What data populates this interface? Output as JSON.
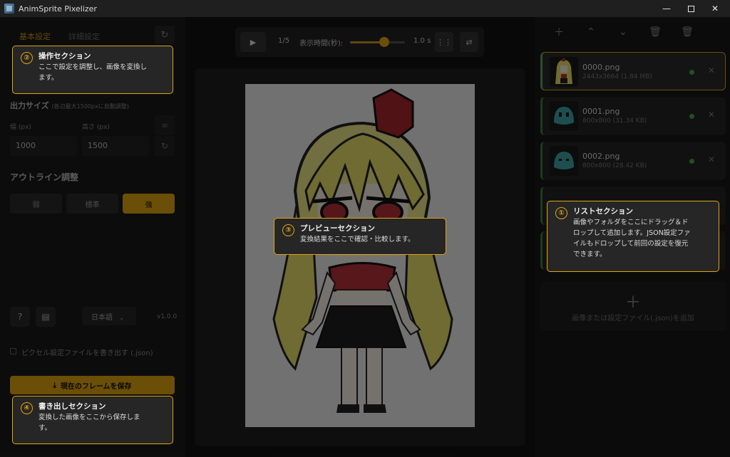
{
  "window": {
    "title": "AnimSprite Pixelizer",
    "minimize": "—",
    "close": "✕"
  },
  "settings": {
    "tab_basic": "基本設定",
    "tab_advanced": "詳細設定",
    "output_size_label": "出力サイズ",
    "output_size_note": "(各辺最大1500pxに自動調整)",
    "width_label": "幅 (px)",
    "width_value": "1000",
    "height_label": "高さ (px)",
    "height_value": "1500",
    "outline_label": "アウトライン調整",
    "outline_options": [
      "弱",
      "標準",
      "強"
    ],
    "outline_selected": "強",
    "language": "日本語",
    "version": "v1.0.0",
    "export_checkbox_label": "ピクセル設定ファイルを書き出す (.json)",
    "save_frame_button": "現在のフレームを保存"
  },
  "preview": {
    "frame_counter": "1/5",
    "display_time_label": "表示時間(秒):",
    "display_time_value": "1.0 s",
    "display_time_fraction": 0.62
  },
  "file_list": {
    "items": [
      {
        "name": "0000.png",
        "info": "2443x3664 (1.84 MB)"
      },
      {
        "name": "0001.png",
        "info": "800x800 (31.34 KB)"
      },
      {
        "name": "0002.png",
        "info": "800x800 (28.42 KB)"
      }
    ],
    "add_label": "画像または設定ファイル(.json)を追加"
  },
  "callouts": {
    "list": {
      "number": "①",
      "title": "リストセクション",
      "body_lines": [
        "画像やフォルダをここにドラッグ＆ド",
        "ロップして追加します。JSON設定ファ",
        "イルもドロップして前回の設定を復元",
        "できます。"
      ]
    },
    "controls": {
      "number": "②",
      "title": "操作セクション",
      "body_lines": [
        "ここで設定を調整し、画像を変換し",
        "ます。"
      ]
    },
    "preview": {
      "number": "③",
      "title": "プレビューセクション",
      "body_lines": [
        "変換結果をここで確認・比較します。"
      ]
    },
    "export": {
      "number": "④",
      "title": "書き出しセクション",
      "body_lines": [
        "変換した画像をここから保存しま",
        "す。"
      ]
    }
  },
  "icons": [
    "reset-icon",
    "link-icon",
    "help-icon",
    "document-icon",
    "play-icon",
    "grid-icon",
    "swap-icon",
    "plus-icon",
    "arrow-up-icon",
    "arrow-down-icon",
    "trash-icon",
    "delete-all-icon",
    "download-icon",
    "close-icon",
    "status-dot-icon"
  ],
  "colors": {
    "accent": "#e0a411",
    "status_ok": "#45a845"
  }
}
